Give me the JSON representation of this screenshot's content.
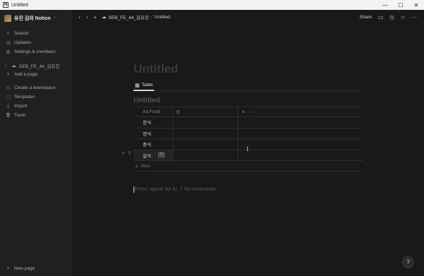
{
  "window": {
    "app_icon": "N",
    "title": "Untitled",
    "minimize_icon": "—",
    "maximize_icon": "☐",
    "close_icon": "✕"
  },
  "sidebar": {
    "workspace_name": "유진 김의 Notion",
    "workspace_chevron": "⌃",
    "items": [
      {
        "icon": "⌕",
        "label": "Search"
      },
      {
        "icon": "◷",
        "label": "Updates"
      },
      {
        "icon": "⚙",
        "label": "Settings & members"
      }
    ],
    "pages": [
      {
        "icon": "☁",
        "toggle": "›",
        "label": "SEB_FE_44_김유진"
      },
      {
        "icon": "+",
        "label": "Add a page"
      }
    ],
    "tools": [
      {
        "icon": "⚇",
        "label": "Create a teamspace"
      },
      {
        "icon": "⬚",
        "label": "Templates"
      },
      {
        "icon": "⤓",
        "label": "Import"
      },
      {
        "icon": "🗑",
        "label": "Trash"
      }
    ],
    "new_page": {
      "icon": "+",
      "label": "New page"
    }
  },
  "topbar": {
    "back": "‹",
    "forward": "›",
    "add": "+",
    "breadcrumb": {
      "icon": "☁",
      "parent": "SEB_FE_44_김유진",
      "sep": "/",
      "current": "Untitled"
    },
    "share": "Share",
    "comment_icon": "▭",
    "history_icon": "◷",
    "favorite_icon": "☆",
    "more_icon": "⋯"
  },
  "page": {
    "title": "Untitled",
    "tab": {
      "icon": "▦",
      "label": "Table"
    },
    "database_title": "Untitled",
    "table": {
      "column_header": "Aa Food",
      "extra_column_icon": "☰",
      "add_column": "+",
      "more": "⋯",
      "rows": [
        "한식",
        "양식",
        "중식",
        "일식"
      ],
      "open_chip": "▤",
      "row_add": "+",
      "row_drag": "⠿",
      "new_row": "New"
    },
    "prompt": "Press 'space' for AI, '/' for commands...",
    "cursor": "I",
    "help": "?"
  }
}
